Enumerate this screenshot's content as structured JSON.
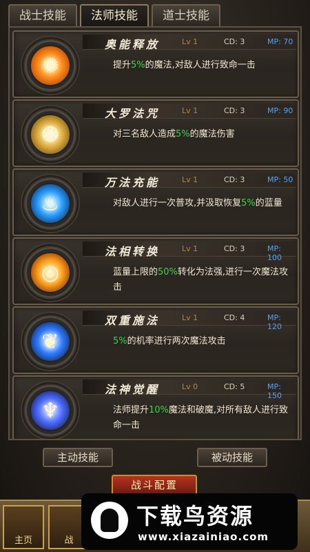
{
  "tabs": [
    {
      "label": "战士技能"
    },
    {
      "label": "法师技能"
    },
    {
      "label": "道士技能"
    }
  ],
  "skills": [
    {
      "name": "奥能释放",
      "lv": "Lv 1",
      "cd": "CD: 3",
      "mp": "MP: 70",
      "desc": [
        [
          "提升"
        ],
        [
          "5%",
          "hl"
        ],
        [
          "的魔法,对敌人进行致命一击"
        ]
      ],
      "icon": "arcane-burst-icon",
      "color": "#ff8a1a"
    },
    {
      "name": "大罗法咒",
      "lv": "Lv 1",
      "cd": "CD: 3",
      "mp": "MP: 90",
      "desc": [
        [
          "对三名敌人造成"
        ],
        [
          "5%",
          "hl"
        ],
        [
          "的魔法伤害"
        ]
      ],
      "icon": "golden-curse-icon",
      "color": "#e0b040"
    },
    {
      "name": "万法充能",
      "lv": "Lv 1",
      "cd": "CD: 3",
      "mp": "MP: 50",
      "desc": [
        [
          "对敌人进行一次普攻,并汲取恢复"
        ],
        [
          "5%",
          "hl"
        ],
        [
          "的蓝量"
        ]
      ],
      "icon": "blue-flame-icon",
      "color": "#2a9cff"
    },
    {
      "name": "法相转换",
      "lv": "Lv 1",
      "cd": "CD: 3",
      "mp": "MP: 100",
      "desc": [
        [
          "蓝量上限的"
        ],
        [
          "50%",
          "hl"
        ],
        [
          "转化为法强,进行一次魔法攻击"
        ]
      ],
      "icon": "orb-runes-icon",
      "color": "#ff9f1c"
    },
    {
      "name": "双重施法",
      "lv": "Lv 1",
      "cd": "CD: 4",
      "mp": "MP: 120",
      "desc": [
        [
          "5%",
          "hl"
        ],
        [
          "的机率进行两次魔法攻击"
        ]
      ],
      "icon": "blue-wings-icon",
      "color": "#2f7cff"
    },
    {
      "name": "法神觉醒",
      "lv": "Lv 0",
      "cd": "CD: 5",
      "mp": "MP: 150",
      "desc": [
        [
          "法师提升"
        ],
        [
          "10%",
          "hl"
        ],
        [
          "魔法和破魔,对所有敌人进行致命一击"
        ]
      ],
      "icon": "mage-awaken-icon",
      "color": "#4a6cff"
    }
  ],
  "buttons": {
    "active_skills": "主动技能",
    "passive_skills": "被动技能",
    "battle_config": "战斗配置"
  },
  "nav": {
    "item1": "主页",
    "item2": "战"
  },
  "watermark": {
    "title": "下载鸟资源",
    "url": "www.xiazainiao.com"
  },
  "colors": {
    "highlight": "#3fd24a",
    "mp": "#4ea4ff",
    "level": "#b08a3a"
  }
}
